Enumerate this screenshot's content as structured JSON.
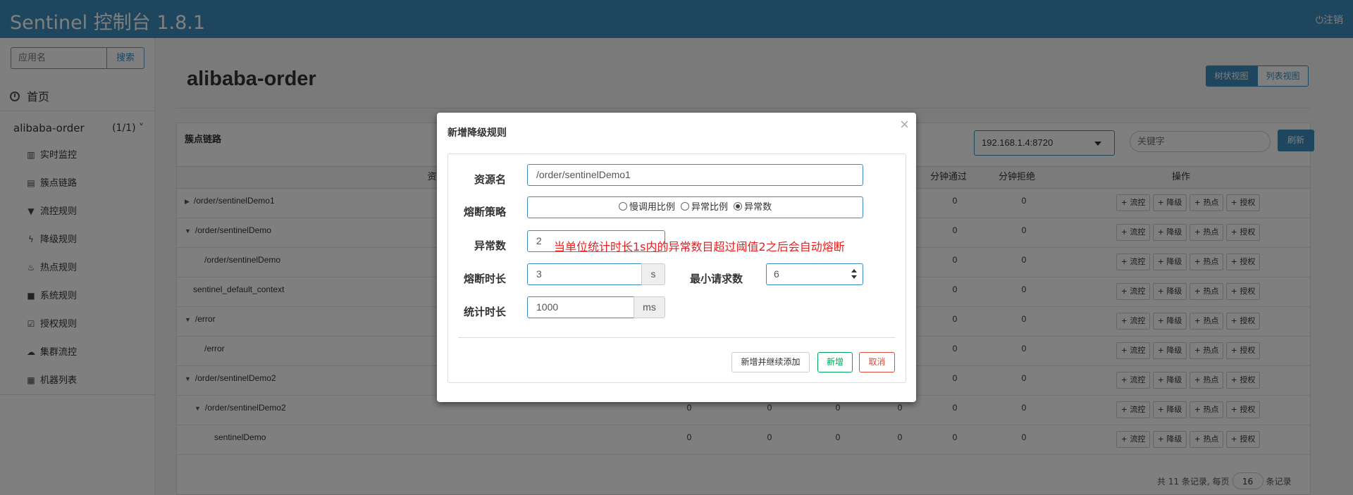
{
  "header": {
    "brand": "Sentinel 控制台 1.8.1",
    "logout": "⏻注销"
  },
  "sidebar": {
    "search_placeholder": "应用名",
    "search_button": "搜索",
    "home": "首页",
    "app_name": "alibaba-order",
    "app_count": "(1/1)",
    "items": [
      {
        "label": "实时监控",
        "icon": "bar-chart-icon"
      },
      {
        "label": "簇点链路",
        "icon": "list-icon"
      },
      {
        "label": "流控规则",
        "icon": "filter-icon"
      },
      {
        "label": "降级规则",
        "icon": "flash-icon"
      },
      {
        "label": "热点规则",
        "icon": "fire-icon"
      },
      {
        "label": "系统规则",
        "icon": "lock-icon"
      },
      {
        "label": "授权规则",
        "icon": "check-icon"
      },
      {
        "label": "集群流控",
        "icon": "cloud-icon"
      },
      {
        "label": "机器列表",
        "icon": "grid-icon"
      }
    ]
  },
  "main": {
    "title": "alibaba-order",
    "view_tree": "树状视图",
    "view_list": "列表视图",
    "panel_title": "簇点链路",
    "machine": "192.168.1.4:8720",
    "keyword_placeholder": "关键字",
    "refresh": "刷新",
    "columns": {
      "resource": "资源名",
      "pass_per_min": "分钟通过",
      "block_per_min": "分钟拒绝",
      "actions": "操作"
    },
    "rows": [
      {
        "name": "/order/sentinelDemo1",
        "marker": "▶",
        "indent": 0,
        "c1": "",
        "c2": "",
        "c3": "",
        "c4": "",
        "pass": "0",
        "block": "0"
      },
      {
        "name": "/order/sentinelDemo",
        "marker": "▼",
        "indent": 0,
        "c1": "",
        "c2": "",
        "c3": "",
        "c4": "",
        "pass": "0",
        "block": "0"
      },
      {
        "name": "/order/sentinelDemo",
        "marker": "",
        "indent": 1,
        "c1": "",
        "c2": "",
        "c3": "",
        "c4": "",
        "pass": "0",
        "block": "0"
      },
      {
        "name": "sentinel_default_context",
        "marker": "",
        "indent": -1,
        "c1": "",
        "c2": "",
        "c3": "",
        "c4": "",
        "pass": "0",
        "block": "0"
      },
      {
        "name": "/error",
        "marker": "▼",
        "indent": 0,
        "c1": "",
        "c2": "",
        "c3": "",
        "c4": "",
        "pass": "0",
        "block": "0"
      },
      {
        "name": "/error",
        "marker": "",
        "indent": 1,
        "c1": "",
        "c2": "",
        "c3": "",
        "c4": "",
        "pass": "0",
        "block": "0"
      },
      {
        "name": "/order/sentinelDemo2",
        "marker": "▼",
        "indent": 0,
        "c1": "",
        "c2": "",
        "c3": "",
        "c4": "",
        "pass": "0",
        "block": "0"
      },
      {
        "name": "/order/sentinelDemo2",
        "marker": "▼",
        "indent": 2,
        "c1": "0",
        "c2": "0",
        "c3": "0",
        "c4": "0",
        "pass": "0",
        "block": "0"
      },
      {
        "name": "sentinelDemo",
        "marker": "",
        "indent": 3,
        "c1": "0",
        "c2": "0",
        "c3": "0",
        "c4": "0",
        "pass": "0",
        "block": "0"
      }
    ],
    "row_actions": [
      "+ 流控",
      "+ 降级",
      "+ 热点",
      "+ 授权"
    ],
    "footer_prefix": "共 11 条记录, 每页",
    "page_size": "16",
    "footer_suffix": "条记录"
  },
  "modal": {
    "title": "新增降级规则",
    "close": "×",
    "resource_label": "资源名",
    "resource_value": "/order/sentinelDemo1",
    "strategy_label": "熔断策略",
    "strategies": [
      {
        "label": "慢调用比例",
        "selected": false
      },
      {
        "label": "异常比例",
        "selected": false
      },
      {
        "label": "异常数",
        "selected": true
      }
    ],
    "exception_count_label": "异常数",
    "exception_count_value": "2",
    "annotation": "当单位统计时长1s内的异常数目超过阈值2之后会自动熔断",
    "duration_label": "熔断时长",
    "duration_value": "3",
    "duration_unit": "s",
    "min_request_label": "最小请求数",
    "min_request_value": "6",
    "stat_label": "统计时长",
    "stat_value": "1000",
    "stat_unit": "ms",
    "btn_add_continue": "新增并继续添加",
    "btn_add": "新增",
    "btn_cancel": "取消",
    "colors": {
      "add": "#00a65a",
      "cancel": "#dd4b39",
      "annotation": "#e82020"
    }
  }
}
